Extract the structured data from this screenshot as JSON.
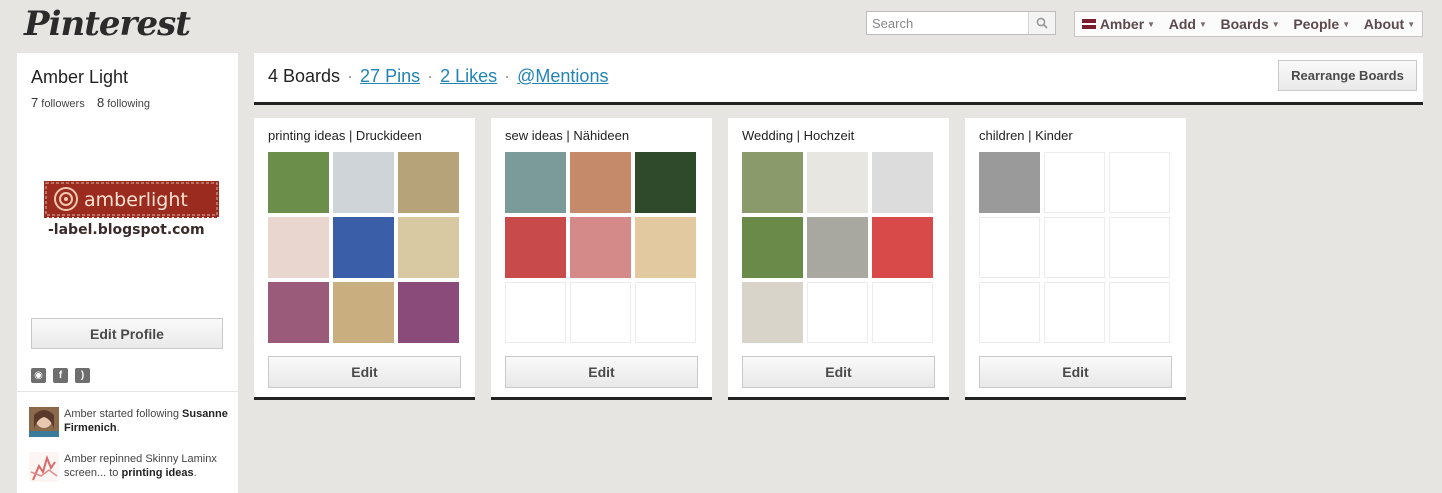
{
  "header": {
    "logo": "Pinterest",
    "search_placeholder": "Search",
    "nav": [
      {
        "label": "Amber"
      },
      {
        "label": "Add"
      },
      {
        "label": "Boards"
      },
      {
        "label": "People"
      },
      {
        "label": "About"
      }
    ]
  },
  "profile": {
    "name": "Amber Light",
    "followers_count": "7",
    "followers_label": "followers",
    "following_count": "8",
    "following_label": "following",
    "banner_line1": "amberlight",
    "banner_line2": "-label.blogspot.com",
    "edit_profile_label": "Edit Profile"
  },
  "activity": [
    {
      "text": "Amber started following",
      "bold": "Susanne Firmenich",
      "suffix": "."
    },
    {
      "text": "Amber repinned Skinny Laminx screen... to",
      "bold": "printing ideas",
      "suffix": "."
    }
  ],
  "stats": {
    "boards": "4 Boards",
    "pins": "27 Pins",
    "likes": "2 Likes",
    "mentions": "@Mentions",
    "separator": "·",
    "rearrange_label": "Rearrange Boards"
  },
  "boards": [
    {
      "title": "printing ideas | Druckideen",
      "edit_label": "Edit",
      "thumbs": [
        "#6b8f4a",
        "#cfd4d8",
        "#b7a37a",
        "#e9d6cf",
        "#3a5fa8",
        "#d8c9a3",
        "#9a5a7a",
        "#c9ae80",
        "#8a4a7a"
      ]
    },
    {
      "title": "sew ideas | Nähideen",
      "edit_label": "Edit",
      "thumbs": [
        "#7b9a9a",
        "#c48a6a",
        "#2f4a2a",
        "#c84a4a",
        "#d58a8a",
        "#e3c9a0",
        "",
        "",
        ""
      ]
    },
    {
      "title": "Wedding | Hochzeit",
      "edit_label": "Edit",
      "thumbs": [
        "#8a9a6a",
        "#e8e6e0",
        "#dcdcdc",
        "#6a8a4a",
        "#a8a8a0",
        "#d84a4a",
        "#d8d4ca",
        "",
        ""
      ]
    },
    {
      "title": "children | Kinder",
      "edit_label": "Edit",
      "thumbs": [
        "#9a9a9a",
        "",
        "",
        "",
        "",
        "",
        "",
        "",
        ""
      ]
    }
  ],
  "icons": {
    "search": "search-icon",
    "pin_social": "pinterest-icon",
    "facebook": "facebook-icon",
    "rss": "rss-icon"
  },
  "colors": {
    "background": "#e6e5e1",
    "link": "#2184b5",
    "board_border": "#222222"
  }
}
